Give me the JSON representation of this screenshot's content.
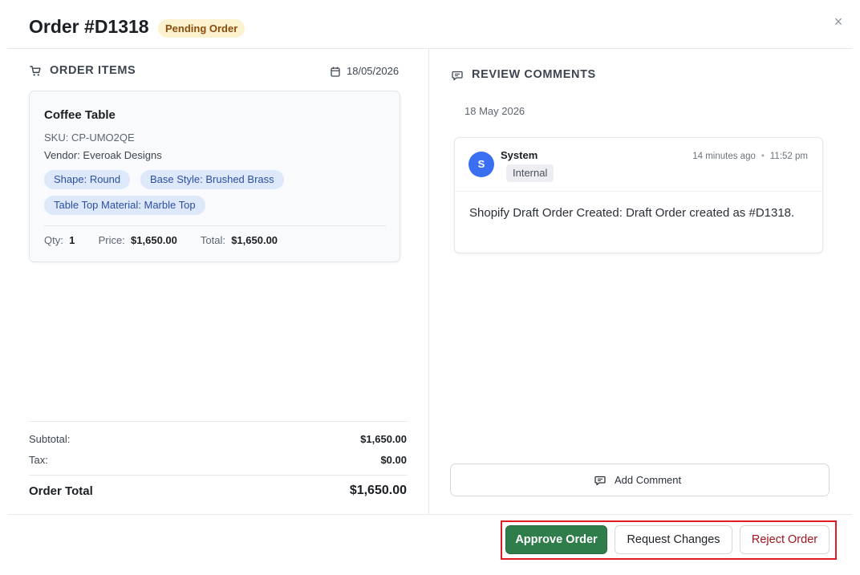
{
  "header": {
    "title": "Order #D1318",
    "status": "Pending Order",
    "close_symbol": "×"
  },
  "order_items": {
    "section_label": "ORDER ITEMS",
    "date": "18/05/2026",
    "items": [
      {
        "name": "Coffee Table",
        "sku": "SKU: CP-UMO2QE",
        "vendor": "Vendor: Everoak Designs",
        "options": [
          "Shape: Round",
          "Base Style: Brushed Brass",
          "Table Top Material: Marble Top"
        ],
        "qty_label": "Qty:",
        "qty": "1",
        "price_label": "Price:",
        "price": "$1,650.00",
        "total_label": "Total:",
        "total": "$1,650.00"
      }
    ]
  },
  "totals": {
    "subtotal_label": "Subtotal:",
    "subtotal": "$1,650.00",
    "tax_label": "Tax:",
    "tax": "$0.00",
    "order_total_label": "Order Total",
    "order_total": "$1,650.00"
  },
  "review": {
    "section_label": "REVIEW COMMENTS",
    "date_group": "18 May 2026",
    "comments": [
      {
        "avatar_initial": "S",
        "author": "System",
        "tag": "Internal",
        "relative_time": "14 minutes ago",
        "time": "11:52 pm",
        "body": "Shopify Draft Order Created: Draft Order created as #D1318."
      }
    ],
    "add_comment_label": "Add Comment"
  },
  "actions": {
    "approve": "Approve Order",
    "request_changes": "Request Changes",
    "reject": "Reject Order"
  },
  "colors": {
    "approve_bg": "#2f7d4b",
    "reject_text": "#a3161d",
    "badge_bg": "#fdf2cf",
    "chip_bg": "#dde8fb",
    "avatar_bg": "#3b6ff2",
    "highlight_border": "#e01b24"
  },
  "icons": {
    "order_items": "cart-icon",
    "date": "calendar-icon",
    "review": "comment-icon",
    "add_comment": "comment-icon",
    "close": "close-icon"
  }
}
